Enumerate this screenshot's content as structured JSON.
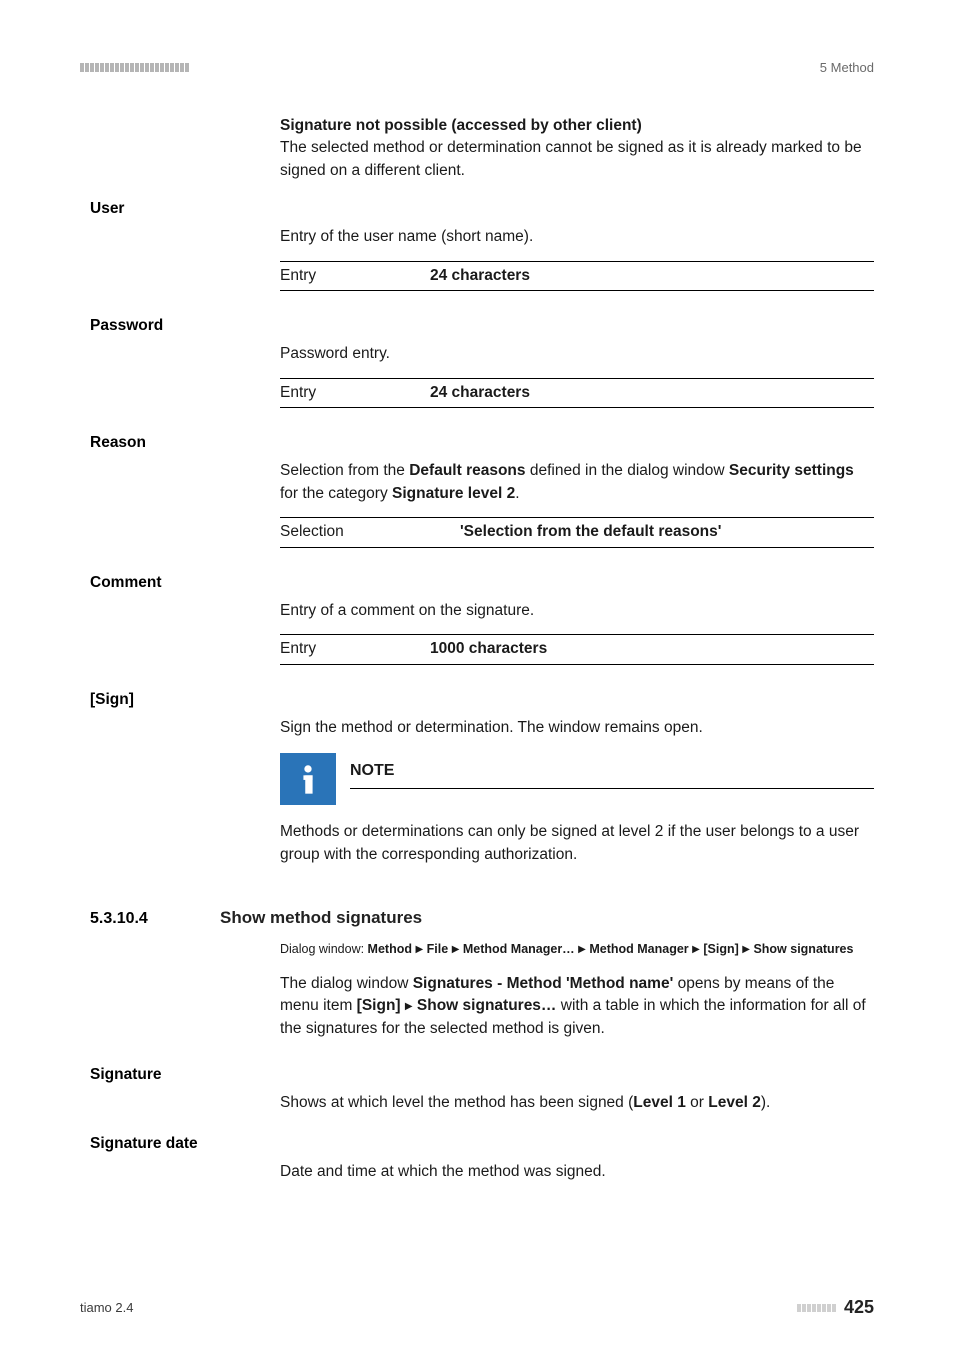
{
  "header": {
    "chapter": "5 Method"
  },
  "topBold": {
    "title": "Signature not possible (accessed by other client)",
    "body": "The selected method or determination cannot be signed as it is already marked to be signed on a different client."
  },
  "user": {
    "term": "User",
    "desc": "Entry of the user name (short name).",
    "entryLabel": "Entry",
    "entryValue": "24 characters"
  },
  "password": {
    "term": "Password",
    "desc": "Password entry.",
    "entryLabel": "Entry",
    "entryValue": "24 characters"
  },
  "reason": {
    "term": "Reason",
    "desc1a": "Selection from the ",
    "desc1b": "Default reasons",
    "desc1c": " defined in the dialog window ",
    "desc1d": "Security settings",
    "desc1e": " for the category ",
    "desc1f": "Signature level 2",
    "desc1g": ".",
    "selLabel": "Selection",
    "selValue": "'Selection from the default reasons'"
  },
  "comment": {
    "term": "Comment",
    "desc": "Entry of a comment on the signature.",
    "entryLabel": "Entry",
    "entryValue": "1000 characters"
  },
  "sign": {
    "term": "[Sign]",
    "desc": "Sign the method or determination. The window remains open."
  },
  "note": {
    "title": "NOTE",
    "body": "Methods or determinations can only be signed at level 2 if the user belongs to a user group with the corresponding authorization."
  },
  "section": {
    "num": "5.3.10.4",
    "title": "Show method signatures",
    "pathPrefix": "Dialog window: ",
    "path": [
      "Method",
      "File",
      "Method Manager…",
      "Method Manager",
      "[Sign]",
      "Show signatures"
    ],
    "body1a": "The dialog window ",
    "body1b": "Signatures - Method 'Method name'",
    "body1c": " opens by means of the menu item ",
    "body1d": "[Sign]",
    "body1e": "Show signatures…",
    "body1f": " with a table in which the information for all of the signatures for the selected method is given."
  },
  "signature": {
    "term": "Signature",
    "desc1": "Shows at which level the method has been signed (",
    "desc2": "Level 1",
    "desc3": " or ",
    "desc4": "Level 2",
    "desc5": ")."
  },
  "sigdate": {
    "term": "Signature date",
    "desc": "Date and time at which the method was signed."
  },
  "footer": {
    "left": "tiamo 2.4",
    "page": "425"
  }
}
